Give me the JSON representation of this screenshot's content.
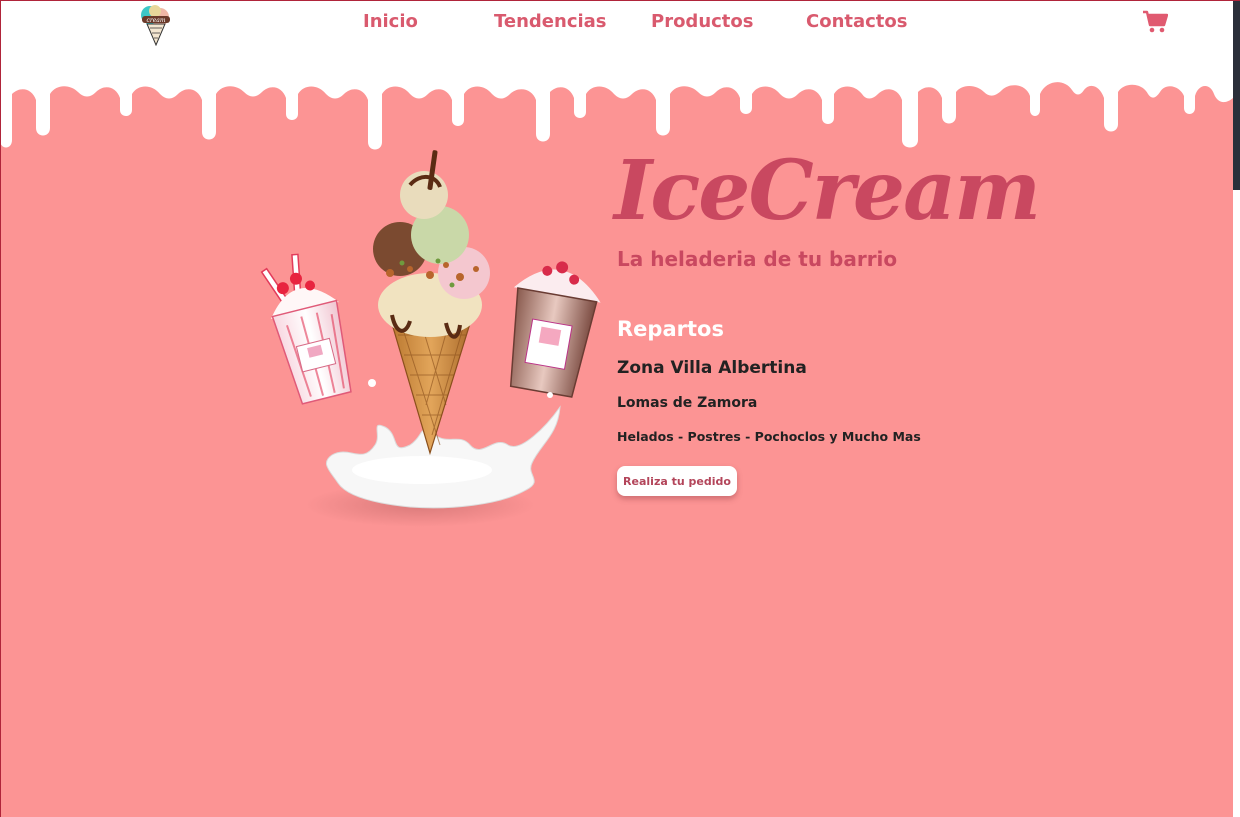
{
  "nav": {
    "items": [
      {
        "label": "Inicio"
      },
      {
        "label": "Tendencias"
      },
      {
        "label": "Productos"
      },
      {
        "label": "Contactos"
      }
    ],
    "link_color": "#d95a6e"
  },
  "logo": {
    "text": "Ice Cream"
  },
  "cart": {
    "icon": "cart-icon"
  },
  "hero": {
    "title": "IceCream",
    "subtitle": "La heladeria de tu barrio",
    "repartos": "Repartos",
    "zona": "Zona Villa Albertina",
    "lomas": "Lomas de Zamora",
    "productos": "Helados - Postres - Pochoclos y Mucho Mas",
    "cta": "Realiza tu pedido"
  },
  "colors": {
    "background": "#fc9494",
    "title": "#c94860",
    "white": "#ffffff"
  }
}
